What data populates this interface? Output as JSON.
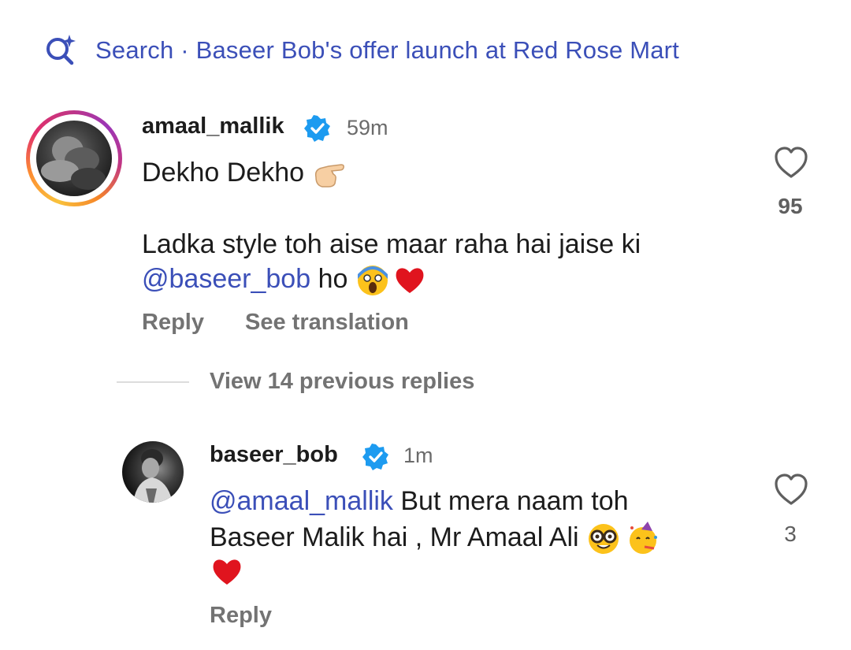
{
  "search": {
    "label": "Search",
    "separator": " · ",
    "query": "Baseer Bob's offer launch at Red Rose Mart"
  },
  "comment": {
    "username": "amaal_mallik",
    "time": "59m",
    "line1": "Dekho Dekho",
    "line2": "Ladka style toh aise maar raha hai jaise ki",
    "mention": "@baseer_bob",
    "line3_suffix": " ho",
    "likes": "95",
    "reply_label": "Reply",
    "translate_label": "See translation",
    "view_replies_label": "View 14 previous replies"
  },
  "reply": {
    "username": "baseer_bob",
    "time": "1m",
    "mention": "@amaal_mallik",
    "line1_suffix": " But mera naam toh",
    "line2": "Baseer Malik hai , Mr Amaal Ali",
    "likes": "3",
    "reply_label": "Reply"
  },
  "icons": {
    "search": "search-sparkle-icon",
    "verified": "verified-badge-icon",
    "heart": "heart-outline-icon",
    "emojis": [
      "pointing-hand-emoji",
      "scream-emoji",
      "red-heart-emoji",
      "nerd-face-emoji",
      "party-face-emoji"
    ]
  },
  "colors": {
    "link": "#3b4fb8",
    "verified": "#1d9bf0",
    "muted": "#737373"
  }
}
